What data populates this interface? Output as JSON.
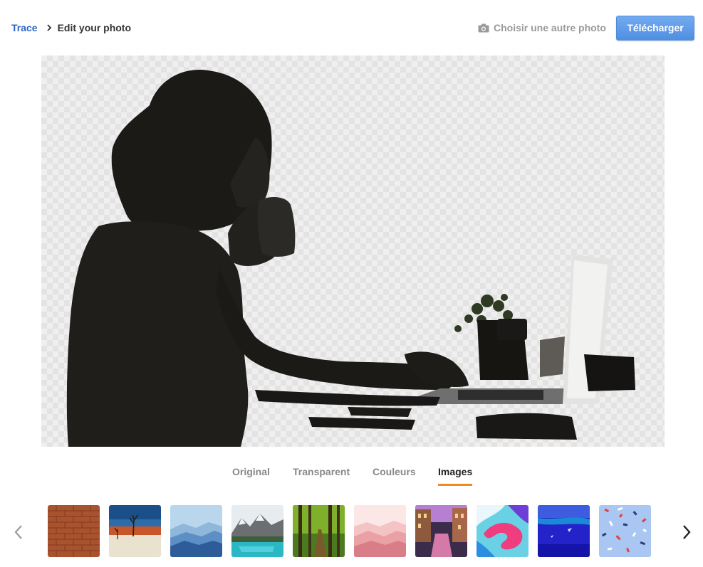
{
  "header": {
    "breadcrumb_root": "Trace",
    "breadcrumb_current": "Edit your photo",
    "choose_photo_label": "Choisir une autre photo",
    "download_label": "Télécharger"
  },
  "tabs": [
    {
      "label": "Original",
      "active": false
    },
    {
      "label": "Transparent",
      "active": false
    },
    {
      "label": "Couleurs",
      "active": false
    },
    {
      "label": "Images",
      "active": true
    }
  ],
  "colors": {
    "link": "#2f63c4",
    "primary_button": "#5b99e6",
    "tab_active_underline": "#f08a21",
    "muted_text": "#9a9a9a"
  },
  "icons": {
    "breadcrumb_separator": "chevron-right-icon",
    "choose_photo": "camera-icon",
    "prev": "chevron-left-icon",
    "next": "chevron-right-icon"
  },
  "thumbnails": [
    {
      "name": "brick-wall"
    },
    {
      "name": "desert-trees"
    },
    {
      "name": "blue-mountains"
    },
    {
      "name": "lake-mountains"
    },
    {
      "name": "forest-path"
    },
    {
      "name": "pink-mountains"
    },
    {
      "name": "venice-canal"
    },
    {
      "name": "paint-swirl"
    },
    {
      "name": "underwater-blue"
    },
    {
      "name": "confetti"
    }
  ]
}
